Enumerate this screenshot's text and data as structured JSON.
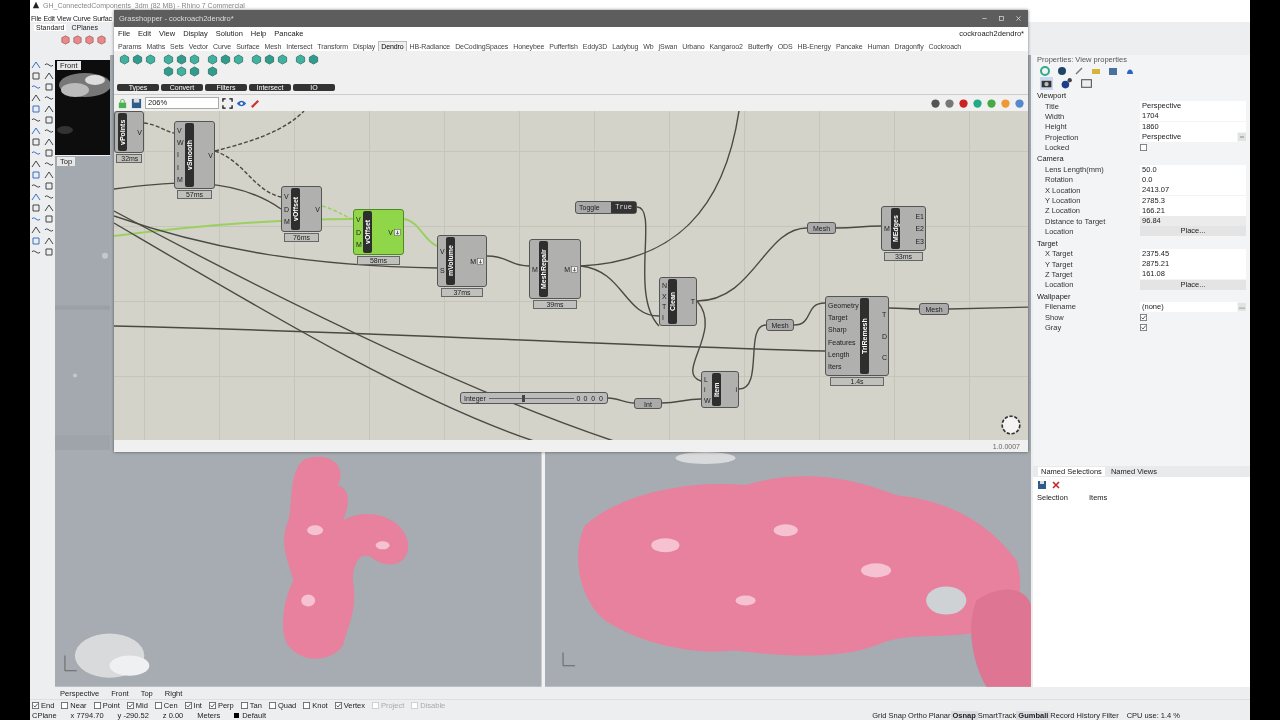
{
  "rhino": {
    "title": "GH_ConnectedComponents_3dm (82 MB) - Rhino 7 Commercial",
    "menu": [
      "File",
      "Edit",
      "View",
      "Curve",
      "Surfac"
    ],
    "toolbar_tabs": [
      {
        "label": "Standard",
        "selected": true
      },
      {
        "label": "CPlanes",
        "selected": false
      }
    ]
  },
  "small_viewports": [
    {
      "label": "Front"
    },
    {
      "label": "Top"
    }
  ],
  "grasshopper": {
    "title": "Grasshopper - cockroach2dendro*",
    "menu": [
      "File",
      "Edit",
      "View",
      "Display",
      "Solution",
      "Help",
      "Pancake"
    ],
    "document": "cockroach2dendro*",
    "tabs": [
      {
        "label": "Params",
        "selected": false
      },
      {
        "label": "Maths",
        "selected": false
      },
      {
        "label": "Sets",
        "selected": false
      },
      {
        "label": "Vector",
        "selected": false
      },
      {
        "label": "Curve",
        "selected": false
      },
      {
        "label": "Surface",
        "selected": false
      },
      {
        "label": "Mesh",
        "selected": false
      },
      {
        "label": "Intersect",
        "selected": false
      },
      {
        "label": "Transform",
        "selected": false
      },
      {
        "label": "Display",
        "selected": false
      },
      {
        "label": "Dendro",
        "selected": true
      },
      {
        "label": "HB-Radiance",
        "selected": false
      },
      {
        "label": "DeCodingSpaces",
        "selected": false
      },
      {
        "label": "Honeybee",
        "selected": false
      },
      {
        "label": "Pufferfish",
        "selected": false
      },
      {
        "label": "Eddy3D",
        "selected": false
      },
      {
        "label": "Ladybug",
        "selected": false
      },
      {
        "label": "Wb",
        "selected": false
      },
      {
        "label": "jSwan",
        "selected": false
      },
      {
        "label": "Urbano",
        "selected": false
      },
      {
        "label": "Kangaroo2",
        "selected": false
      },
      {
        "label": "Butterfly",
        "selected": false
      },
      {
        "label": "ODS",
        "selected": false
      },
      {
        "label": "HB-Energy",
        "selected": false
      },
      {
        "label": "Pancake",
        "selected": false
      },
      {
        "label": "Human",
        "selected": false
      },
      {
        "label": "Dragonfly",
        "selected": false
      },
      {
        "label": "Cockroach",
        "selected": false
      }
    ],
    "groups": [
      {
        "label": "Types"
      },
      {
        "label": "Convert"
      },
      {
        "label": "Filters"
      },
      {
        "label": "Intersect"
      },
      {
        "label": "IO"
      }
    ],
    "zoom": "206%",
    "version": "1.0.0007",
    "nodes": [
      {
        "kind": "component",
        "name": "vPoints",
        "outputs": [
          "V"
        ],
        "time": "32ms",
        "selected": false,
        "expand_icon": false
      },
      {
        "kind": "component",
        "name": "vSmooth",
        "inputs": [
          "V",
          "W",
          "I",
          "I",
          "M"
        ],
        "outputs": [
          "V"
        ],
        "time": "57ms",
        "selected": false,
        "expand_icon": false
      },
      {
        "kind": "component",
        "name": "vOffset",
        "inputs": [
          "V",
          "D",
          "M"
        ],
        "outputs": [
          "V"
        ],
        "time": "76ms",
        "selected": false,
        "expand_icon": false
      },
      {
        "kind": "component",
        "name": "vOffset",
        "inputs": [
          "V",
          "D",
          "M"
        ],
        "outputs": [
          "V"
        ],
        "time": "58ms",
        "selected": true,
        "expand_icon": true
      },
      {
        "kind": "component",
        "name": "mVolume",
        "inputs": [
          "V",
          "S"
        ],
        "outputs": [
          "M"
        ],
        "time": "37ms",
        "selected": false,
        "expand_icon": true
      },
      {
        "kind": "component",
        "name": "MeshRepair",
        "inputs": [
          "M"
        ],
        "outputs": [
          "M"
        ],
        "time": "39ms",
        "selected": false,
        "expand_icon": true
      },
      {
        "kind": "component",
        "name": "Clean",
        "inputs": [
          "N",
          "X",
          "T",
          "I"
        ],
        "outputs": [
          "T"
        ],
        "selected": false,
        "expand_icon": false
      },
      {
        "kind": "component",
        "name": "MEdges",
        "inputs": [
          "M"
        ],
        "outputs": [
          "E1",
          "E2",
          "E3"
        ],
        "time": "33ms",
        "selected": false,
        "expand_icon": false
      },
      {
        "kind": "component",
        "name": "TriRemesh",
        "inputs": [
          "Geometry",
          "Target",
          "Sharp",
          "Features",
          "Length",
          "Iters"
        ],
        "outputs": [
          "T",
          "D",
          "C"
        ],
        "time": "1.4s",
        "selected": false,
        "expand_icon": false
      },
      {
        "kind": "component",
        "name": "Item",
        "inputs": [
          "L",
          "i",
          "W"
        ],
        "outputs": [
          "i"
        ],
        "selected": false,
        "expand_icon": false
      },
      {
        "kind": "toggle",
        "name": "Toggle",
        "value": "True"
      },
      {
        "kind": "slider",
        "name": "Integer",
        "value": "0",
        "digits": "0 0 0",
        "level": 0.4
      },
      {
        "kind": "param",
        "name": "Mesh"
      },
      {
        "kind": "param",
        "name": "Mesh"
      },
      {
        "kind": "param",
        "name": "Mesh"
      },
      {
        "kind": "param",
        "name": "Int"
      }
    ]
  },
  "properties": {
    "title": "Properties: View properties",
    "sections": [
      {
        "title": "Viewport",
        "rows": [
          {
            "label": "Title",
            "kind": "text",
            "value": "Perspective"
          },
          {
            "label": "Width",
            "kind": "text",
            "value": "1704"
          },
          {
            "label": "Height",
            "kind": "text",
            "value": "1860"
          },
          {
            "label": "Projection",
            "kind": "dropdown",
            "value": "Perspective"
          },
          {
            "label": "Locked",
            "kind": "checkbox",
            "checked": false
          }
        ]
      },
      {
        "title": "Camera",
        "rows": [
          {
            "label": "Lens Length(mm)",
            "kind": "text",
            "value": "50.0"
          },
          {
            "label": "Rotation",
            "kind": "text",
            "value": "0.0"
          },
          {
            "label": "X Location",
            "kind": "text",
            "value": "2413.07"
          },
          {
            "label": "Y Location",
            "kind": "text",
            "value": "2785.3"
          },
          {
            "label": "Z Location",
            "kind": "text",
            "value": "166.21"
          },
          {
            "label": "Distance to Target",
            "kind": "readonly",
            "value": "96.84"
          },
          {
            "label": "Location",
            "kind": "button",
            "value": "Place..."
          }
        ]
      },
      {
        "title": "Target",
        "rows": [
          {
            "label": "X Target",
            "kind": "text",
            "value": "2375.45"
          },
          {
            "label": "Y Target",
            "kind": "text",
            "value": "2875.21"
          },
          {
            "label": "Z Target",
            "kind": "text",
            "value": "161.08"
          },
          {
            "label": "Location",
            "kind": "button",
            "value": "Place..."
          }
        ]
      },
      {
        "title": "Wallpaper",
        "rows": [
          {
            "label": "Filename",
            "kind": "file",
            "value": "(none)"
          },
          {
            "label": "Show",
            "kind": "checkbox",
            "checked": true
          },
          {
            "label": "Gray",
            "kind": "checkbox",
            "checked": true
          }
        ]
      }
    ]
  },
  "named_views": {
    "tabs": [
      {
        "label": "Named Selections",
        "selected": true
      },
      {
        "label": "Named Views",
        "selected": false
      }
    ],
    "columns": [
      "Selection",
      "Items"
    ]
  },
  "viewport_tabs": [
    "Perspective",
    "Front",
    "Top",
    "Right"
  ],
  "osnaps": [
    {
      "label": "End",
      "checked": true,
      "disabled": false
    },
    {
      "label": "Near",
      "checked": false,
      "disabled": false
    },
    {
      "label": "Point",
      "checked": false,
      "disabled": false
    },
    {
      "label": "Mid",
      "checked": true,
      "disabled": false
    },
    {
      "label": "Cen",
      "checked": false,
      "disabled": false
    },
    {
      "label": "Int",
      "checked": true,
      "disabled": false
    },
    {
      "label": "Perp",
      "checked": true,
      "disabled": false
    },
    {
      "label": "Tan",
      "checked": false,
      "disabled": false
    },
    {
      "label": "Quad",
      "checked": false,
      "disabled": false
    },
    {
      "label": "Knot",
      "checked": false,
      "disabled": false
    },
    {
      "label": "Vertex",
      "checked": true,
      "disabled": false
    },
    {
      "label": "Project",
      "checked": false,
      "disabled": true
    },
    {
      "label": "Disable",
      "checked": false,
      "disabled": true
    }
  ],
  "status_bar": {
    "coords": [
      "CPlane",
      "x 7794.70",
      "y -290.52",
      "z 0.00",
      "Meters"
    ],
    "layer": "Default",
    "toggles": [
      {
        "label": "Grid Snap",
        "on": false
      },
      {
        "label": "Ortho",
        "on": false
      },
      {
        "label": "Planar",
        "on": false
      },
      {
        "label": "Osnap",
        "on": true
      },
      {
        "label": "SmartTrack",
        "on": false
      },
      {
        "label": "Gumball",
        "on": true
      },
      {
        "label": "Record History",
        "on": false
      },
      {
        "label": "Filter",
        "on": false
      }
    ],
    "cpu": "CPU use: 1.4 %"
  }
}
